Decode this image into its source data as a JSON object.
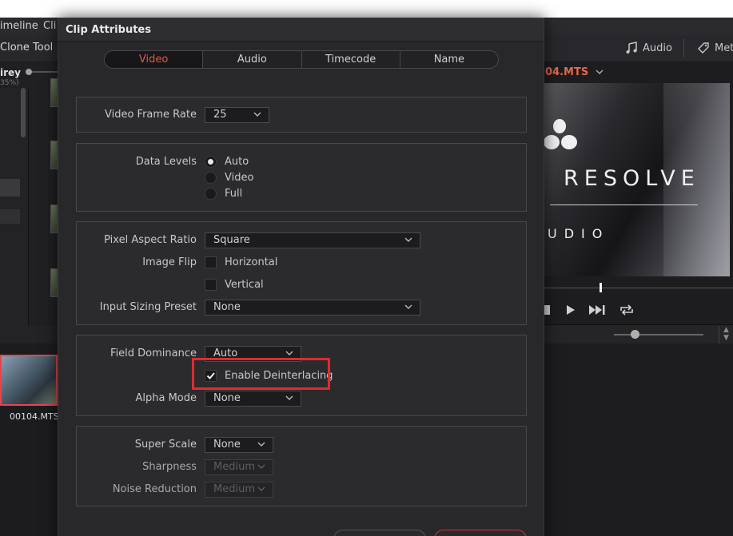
{
  "menubar": {
    "items": [
      "imeline",
      "Cli"
    ]
  },
  "toolbar": {
    "clone_tool": "Clone Tool",
    "audio": "Audio",
    "metadata": "Met"
  },
  "media_pool": {
    "bin_name": "irey",
    "zoom_pct": "35%)",
    "clip_name": "00104.MTS"
  },
  "viewer": {
    "clip_name": "04.MTS",
    "brand_main": "RESOLVE",
    "brand_sub": "UDIO"
  },
  "dialog": {
    "title": "Clip Attributes",
    "tabs": [
      {
        "label": "Video",
        "active": true
      },
      {
        "label": "Audio",
        "active": false
      },
      {
        "label": "Timecode",
        "active": false
      },
      {
        "label": "Name",
        "active": false
      }
    ],
    "frame_rate": {
      "label": "Video Frame Rate",
      "value": "25"
    },
    "data_levels": {
      "label": "Data Levels",
      "options": [
        "Auto",
        "Video",
        "Full"
      ],
      "selected": "Auto"
    },
    "pixel_aspect": {
      "label": "Pixel Aspect Ratio",
      "value": "Square"
    },
    "image_flip": {
      "label": "Image Flip",
      "horizontal": "Horizontal",
      "vertical": "Vertical"
    },
    "input_sizing": {
      "label": "Input Sizing Preset",
      "value": "None"
    },
    "field_dominance": {
      "label": "Field Dominance",
      "value": "Auto"
    },
    "deinterlace": {
      "label": "Enable Deinterlacing",
      "checked": true
    },
    "alpha_mode": {
      "label": "Alpha Mode",
      "value": "None"
    },
    "super_scale": {
      "label": "Super Scale",
      "value": "None"
    },
    "sharpness": {
      "label": "Sharpness",
      "value": "Medium"
    },
    "noise_reduction": {
      "label": "Noise Reduction",
      "value": "Medium"
    }
  },
  "colors": {
    "accent": "#e3574a",
    "highlight": "#e02a2f",
    "dialog_bg": "#28282b"
  }
}
